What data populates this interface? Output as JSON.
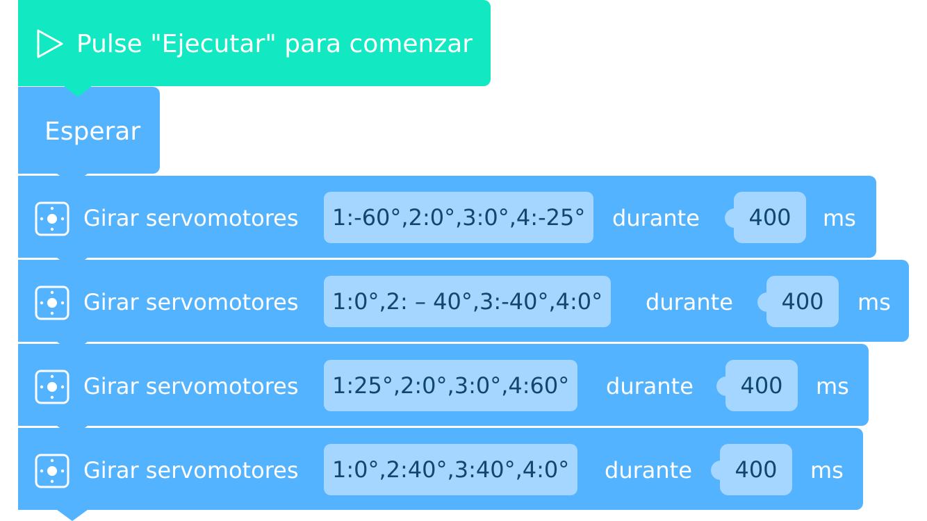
{
  "start": {
    "label": "Pulse \"Ejecutar\" para comenzar",
    "icon": "play-outline-icon",
    "color": "#12e9c2"
  },
  "wait": {
    "label": "Esperar",
    "color": "#54b3ff"
  },
  "servo_blocks": [
    {
      "label": "Girar servomotores",
      "angles": "1:-60°,2:0°,3:0°,4:-25°",
      "during": "durante",
      "duration": "400",
      "unit": "ms"
    },
    {
      "label": "Girar servomotores",
      "angles": "1:0°,2: – 40°,3:-40°,4:0°",
      "during": "durante",
      "duration": "400",
      "unit": "ms"
    },
    {
      "label": "Girar servomotores",
      "angles": "1:25°,2:0°,3:0°,4:60°",
      "during": "durante",
      "duration": "400",
      "unit": "ms"
    },
    {
      "label": "Girar servomotores",
      "angles": "1:0°,2:40°,3:40°,4:0°",
      "during": "durante",
      "duration": "400",
      "unit": "ms"
    }
  ],
  "colors": {
    "block": "#54b3ff",
    "field": "#a4d6ff",
    "field_text": "#12466e"
  }
}
